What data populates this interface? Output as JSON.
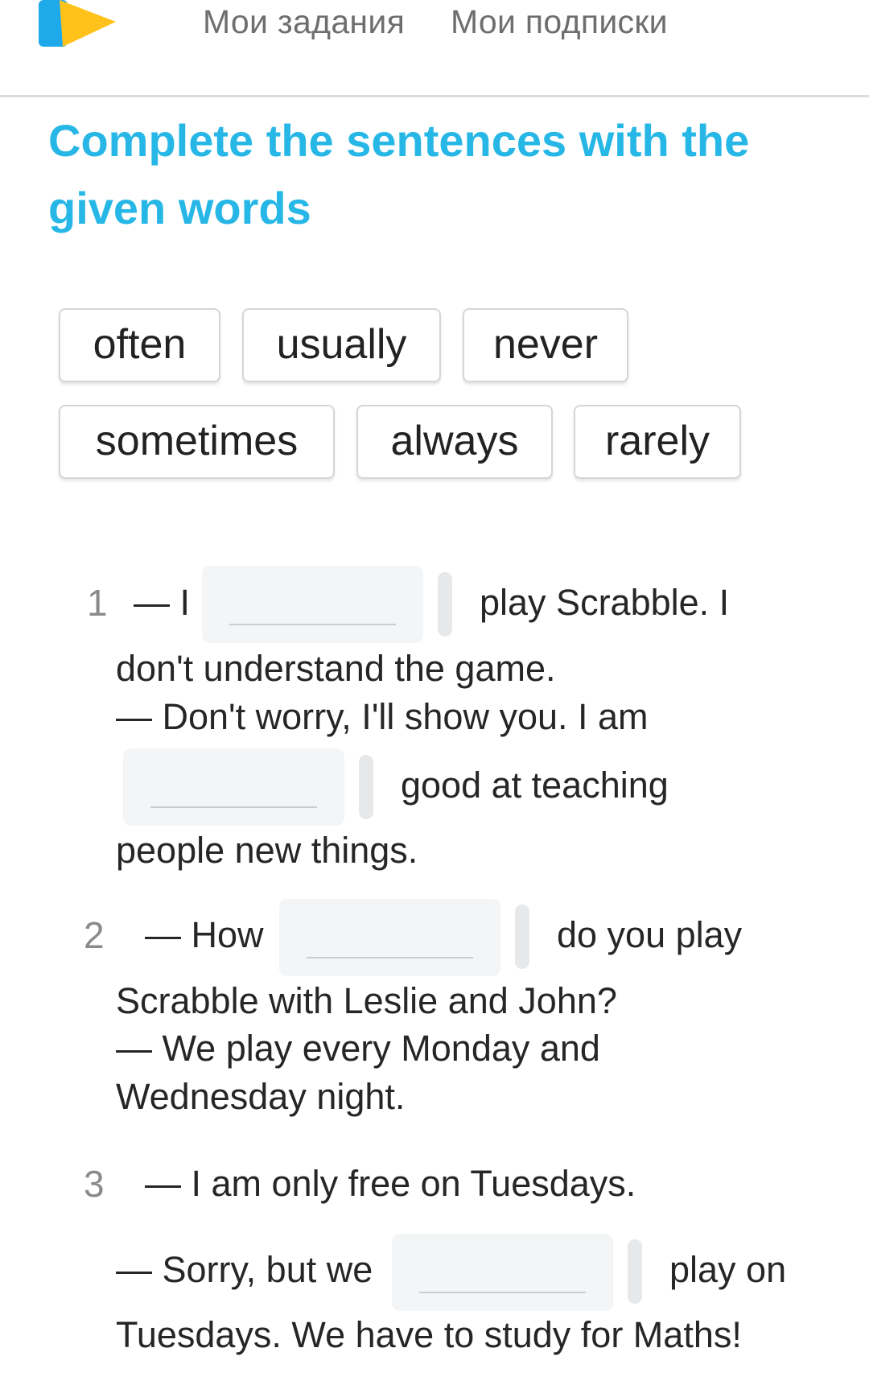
{
  "header": {
    "nav": [
      "Мои задания",
      "Мои подписки"
    ],
    "colors": {
      "logo_blue": "#1ea9ea",
      "logo_yellow": "#ffc21a"
    }
  },
  "exercise": {
    "title": "Complete the sentences with the given words",
    "words": [
      "often",
      "usually",
      "never",
      "sometimes",
      "always",
      "rarely"
    ],
    "items": [
      {
        "number": "1",
        "lines": [
          "— I",
          "play Scrabble. I",
          "don't understand the game.",
          "— Don't worry, I'll show you. I am",
          "good at teaching",
          "people new things."
        ]
      },
      {
        "number": "2",
        "lines": [
          "— How",
          "do you play",
          "Scrabble with Leslie and John?",
          "— We play every Monday and",
          "Wednesday night."
        ]
      },
      {
        "number": "3",
        "lines": [
          "— I am only free on Tuesdays.",
          "— Sorry, but we",
          "play on",
          "Tuesdays. We have to study for Maths!"
        ]
      }
    ],
    "accent_color": "#27b7e6"
  }
}
